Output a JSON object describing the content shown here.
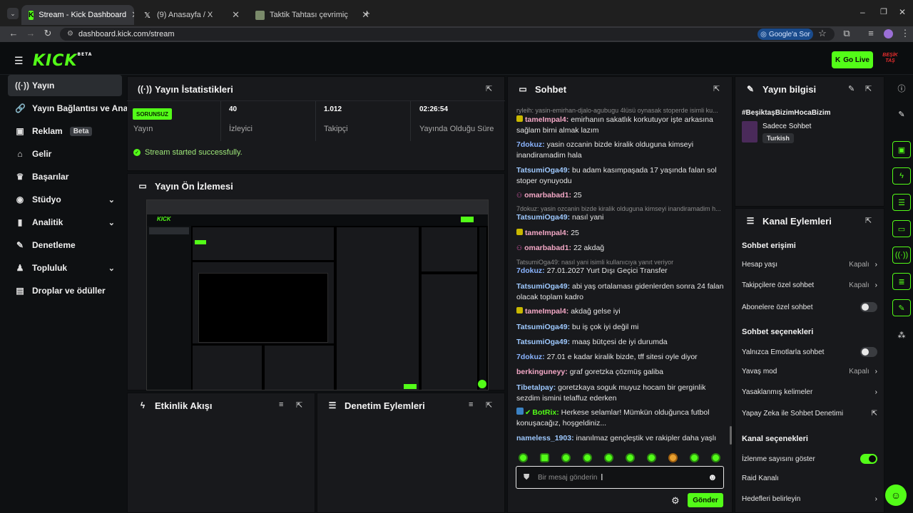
{
  "browser": {
    "tabs": [
      {
        "title": "Stream - Kick Dashboard",
        "icon": "kick-favicon"
      },
      {
        "title": "(9) Anasayfa / X",
        "icon": "x-favicon"
      },
      {
        "title": "Taktik Tahtası çevrimiçi – Futbol",
        "icon": "taktik-favicon"
      }
    ],
    "url": "dashboard.kick.com/stream",
    "google_btn": "Google'a Sor"
  },
  "header": {
    "logo": "KICK",
    "logo_sup": "BETA",
    "go_live": "Go Live"
  },
  "sidebar": {
    "items": [
      {
        "label": "Yayın",
        "icon": "broadcast-icon"
      },
      {
        "label": "Yayın Bağlantısı ve Anahtar",
        "icon": "link-icon"
      },
      {
        "label": "Reklam",
        "icon": "ad-icon",
        "badge": "Beta"
      },
      {
        "label": "Gelir",
        "icon": "bank-icon"
      },
      {
        "label": "Başarılar",
        "icon": "trophy-icon"
      },
      {
        "label": "Stüdyo",
        "icon": "studio-icon"
      },
      {
        "label": "Analitik",
        "icon": "chart-icon"
      },
      {
        "label": "Denetleme",
        "icon": "wrench-icon"
      },
      {
        "label": "Topluluk",
        "icon": "community-icon"
      },
      {
        "label": "Droplar ve ödüller",
        "icon": "gift-icon"
      }
    ]
  },
  "stats": {
    "title": "Yayın İstatistikleri",
    "status_badge": "SORUNSUZ",
    "status_label": "Yayın",
    "viewers_value": "40",
    "viewers_label": "İzleyici",
    "followers_value": "1.012",
    "followers_label": "Takipçi",
    "duration_value": "02:26:54",
    "duration_label": "Yayında Olduğu Süre",
    "success_msg": "Stream started successfully."
  },
  "preview": {
    "title": "Yayın Ön İzlemesi"
  },
  "activity": {
    "title": "Etkinlik Akışı"
  },
  "moderation": {
    "title": "Denetim Eylemleri"
  },
  "chat": {
    "title": "Sohbet",
    "top_reply": "ryleih: yasin-emirhan-djalo-agubugu 4lüsü oynasak stoperde isimli ku...",
    "messages": [
      {
        "user": "tameImpal4",
        "text": "emirhanın sakatlık korkutuyor işte arkasına sağlam birni almak lazım",
        "color": "#f4a8c6",
        "badge": "sub"
      },
      {
        "user": "7dokuz",
        "text": "yasin ozcanin bizde kiralik olduguna kimseyi inandiramadim hala",
        "color": "#8ab4ff"
      },
      {
        "user": "TatsumiOga49",
        "text": "bu adam kasımpaşada 17 yaşında falan sol stoper oynuyodu",
        "color": "#9ec9ff"
      },
      {
        "user": "omarbabad1",
        "text": "25",
        "color": "#f4a8c6",
        "badge": "mod"
      },
      {
        "user": "TatsumiOga49",
        "text": "nasıl yani",
        "color": "#9ec9ff"
      },
      {
        "user": "tameImpal4",
        "text": "25",
        "color": "#f4a8c6",
        "badge": "sub"
      },
      {
        "user": "omarbabad1",
        "text": "22 akdağ",
        "color": "#f4a8c6",
        "badge": "mod"
      },
      {
        "user": "7dokuz",
        "text": "27.01.2027 Yurt Dışı Geçici Transfer",
        "color": "#8ab4ff"
      },
      {
        "user": "TatsumiOga49",
        "text": "abi yaş ortalaması gidenlerden sonra 24 falan olacak toplam kadro",
        "color": "#9ec9ff"
      },
      {
        "user": "tameImpal4",
        "text": "akdağ gelse iyi",
        "color": "#f4a8c6",
        "badge": "sub"
      },
      {
        "user": "TatsumiOga49",
        "text": "bu iş çok iyi değil mi",
        "color": "#9ec9ff"
      },
      {
        "user": "TatsumiOga49",
        "text": "maaş bütçesi de iyi durumda",
        "color": "#9ec9ff"
      },
      {
        "user": "7dokuz",
        "text": "27.01 e kadar kiralik bizde, tff sitesi oyle diyor",
        "color": "#8ab4ff"
      },
      {
        "user": "berkinguneyy",
        "text": "graf goretzka çözmüş galiba",
        "color": "#f4a8c6"
      },
      {
        "user": "Tibetalpay",
        "text": "goretzkaya soguk muyuz hocam bir gerginlik sezdim ismini telaffuz ederken",
        "color": "#9ec9ff"
      },
      {
        "user": "BotRix",
        "text": "Herkese selamlar! Mümkün olduğunca futbol konuşacağız, hoşgeldiniz...",
        "color": "#53fc18",
        "badge": "bot"
      },
      {
        "user": "nameless_1903",
        "text": "inanılmaz gençleştik ve rakipler daha yaşlı",
        "color": "#9ec9ff"
      }
    ],
    "reply_1": "7dokuz: yasin ozcanin bizde kiralik olduguna kimseyi inandiramadim h...",
    "reply_2": "TatsumiOga49: nasıl yani isimli kullanıcıya yanıt veriyor",
    "input_placeholder": "Bir mesaj gönderin",
    "send": "Gönder"
  },
  "stream_info": {
    "title": "Yayın bilgisi",
    "hashtag": "#BeşiktaşBizimHocaBizim",
    "category": "Sadece Sohbet",
    "language": "Turkish"
  },
  "channel_actions": {
    "title": "Kanal Eylemleri",
    "chat_access_title": "Sohbet erişimi",
    "account_age": "Hesap yaşı",
    "account_age_val": "Kapalı",
    "followers_only": "Takipçilere özel sohbet",
    "followers_only_val": "Kapalı",
    "subs_only": "Abonelere özel sohbet",
    "chat_options_title": "Sohbet seçenekleri",
    "emotes_only": "Yalnızca Emotlarla sohbet",
    "slow_mode": "Yavaş mod",
    "slow_mode_val": "Kapalı",
    "banned_words": "Yasaklanmış kelimeler",
    "ai_moderation": "Yapay Zeka ile Sohbet Denetimi",
    "channel_options_title": "Kanal seçenekleri",
    "show_viewcount": "İzlenme sayısını göster",
    "raid_channel": "Raid Kanalı",
    "set_goals": "Hedefleri belirleyin"
  }
}
